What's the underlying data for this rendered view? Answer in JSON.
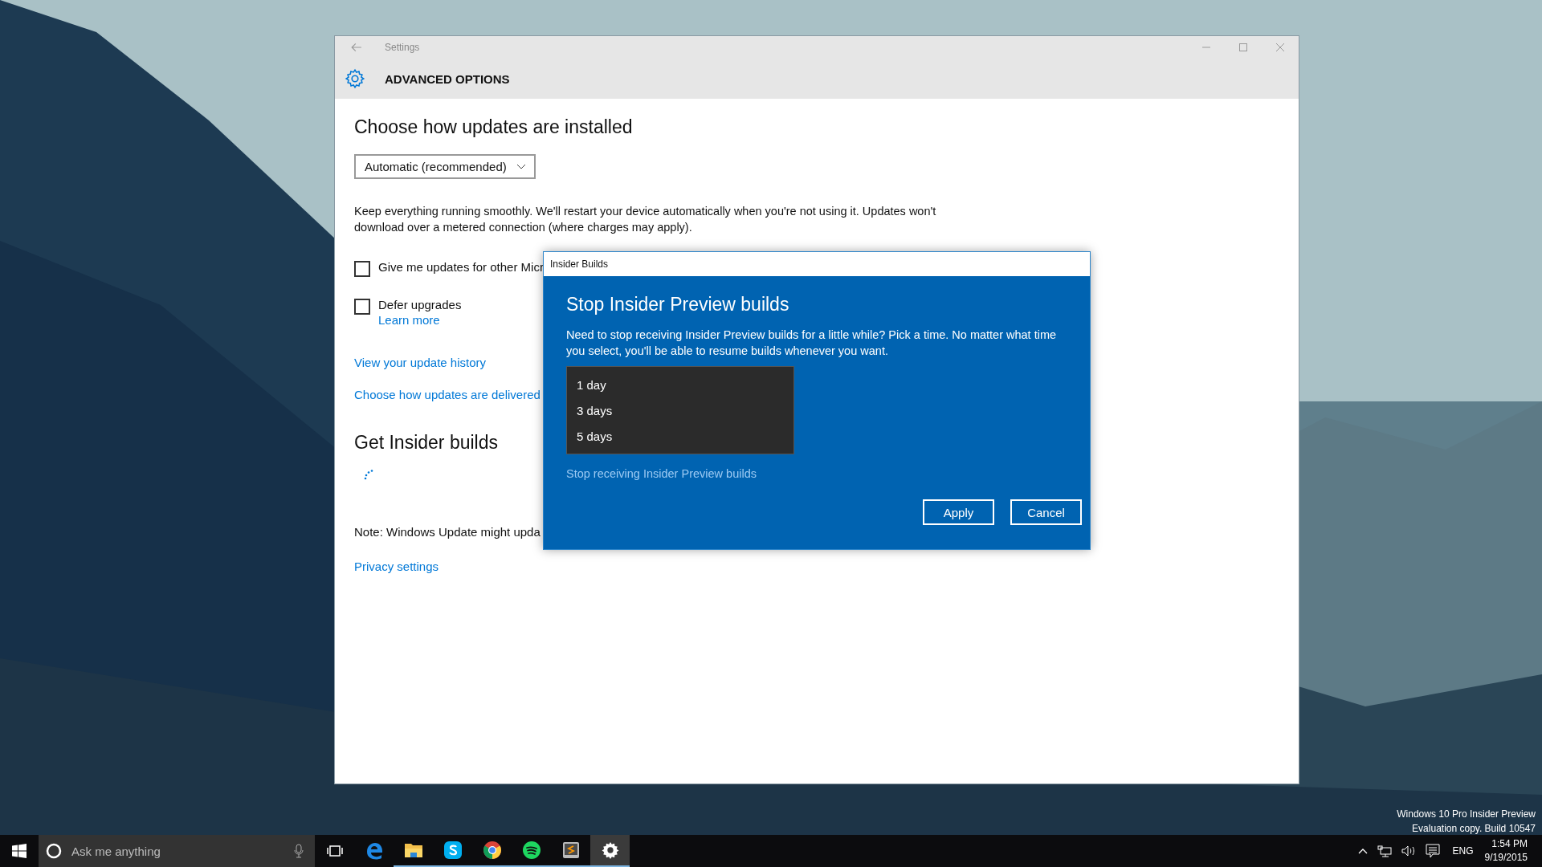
{
  "window": {
    "title": "Settings",
    "header": "ADVANCED OPTIONS"
  },
  "settings": {
    "heading": "Choose how updates are installed",
    "install_mode": "Automatic (recommended)",
    "description": "Keep everything running smoothly. We'll restart your device automatically when you're not using it. Updates won't download over a metered connection (where charges may apply).",
    "options": [
      {
        "label": "Give me updates for other Micr",
        "checked": false
      },
      {
        "label": "Defer upgrades",
        "checked": false,
        "link": "Learn more"
      }
    ],
    "links": [
      "View your update history",
      "Choose how updates are delivered"
    ],
    "insider_heading": "Get Insider builds",
    "note": "Note: Windows Update might upda",
    "privacy_link": "Privacy settings"
  },
  "dialog": {
    "title": "Insider Builds",
    "heading": "Stop Insider Preview builds",
    "text": "Need to stop receiving Insider Preview builds for a little while? Pick a time. No matter what time you select, you'll be able to resume builds whenever you want.",
    "duration_options": [
      {
        "label": "1 day",
        "selected": false
      },
      {
        "label": "3 days",
        "selected": false
      },
      {
        "label": "5 days",
        "selected": false
      }
    ],
    "permanent_link": "Stop receiving Insider Preview builds",
    "buttons": [
      "Apply",
      "Cancel"
    ]
  },
  "desktop_watermark": [
    "Windows 10 Pro Insider Preview",
    "Evaluation copy. Build 10547"
  ],
  "taskbar": {
    "search_placeholder": "Ask me anything",
    "apps": [
      {
        "kind": "taskview",
        "running": false,
        "selected": false
      },
      {
        "kind": "edge",
        "running": false,
        "selected": false
      },
      {
        "kind": "explorer",
        "running": true,
        "selected": false
      },
      {
        "kind": "skype",
        "running": true,
        "selected": false
      },
      {
        "kind": "chrome",
        "running": true,
        "selected": false
      },
      {
        "kind": "spotify",
        "running": true,
        "selected": false
      },
      {
        "kind": "sublime",
        "running": true,
        "selected": false
      },
      {
        "kind": "settings",
        "running": true,
        "selected": true
      }
    ],
    "language": "ENG",
    "time": "1:54 PM",
    "date": "9/19/2015"
  }
}
